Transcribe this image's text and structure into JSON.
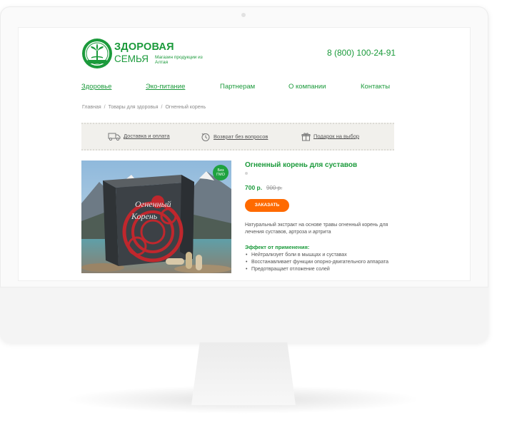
{
  "brand": {
    "name_line1": "ЗДОРОВАЯ",
    "name_line2": "СЕМЬЯ",
    "tagline": "Магазин продукции из Алтая",
    "logo_icon": "leaf-wreath-logo",
    "color": "#1b9a3b"
  },
  "header": {
    "phone": "8 (800) 100-24-91"
  },
  "nav": {
    "items": [
      {
        "label": "Здоровье"
      },
      {
        "label": "Эко-питание"
      },
      {
        "label": "Партнерам"
      },
      {
        "label": "О компании"
      },
      {
        "label": "Контакты"
      }
    ]
  },
  "breadcrumb": [
    "Главная",
    "Товары для здоровья",
    "Огненный корень"
  ],
  "breadcrumb_separator": "/",
  "perks": [
    {
      "icon": "delivery-truck-icon",
      "label": "Доставка и оплата"
    },
    {
      "icon": "return-clock-icon",
      "label": "Возврат без вопросов"
    },
    {
      "icon": "gift-icon",
      "label": "Подарок на выбор"
    }
  ],
  "product": {
    "title": "Огненный корень для суставов",
    "price": "700 р.",
    "old_price": "900 р.",
    "order_button": "ЗАКАЗАТЬ",
    "badge_line1": "Без",
    "badge_line2": "ГМО",
    "box_title": "Огненный Корень",
    "description": "Натуральный экстракт на основе травы огненный корень для лечения суставов, артроза и артрита",
    "effect_heading": "Эффект от применения:",
    "effects": [
      "Нейтрализует боли в мышцах и суставах",
      "Восстанавливает функции опорно-двигательного аппарата",
      "Предотвращает отложение солей"
    ],
    "accent_color": "#ff6a00"
  }
}
